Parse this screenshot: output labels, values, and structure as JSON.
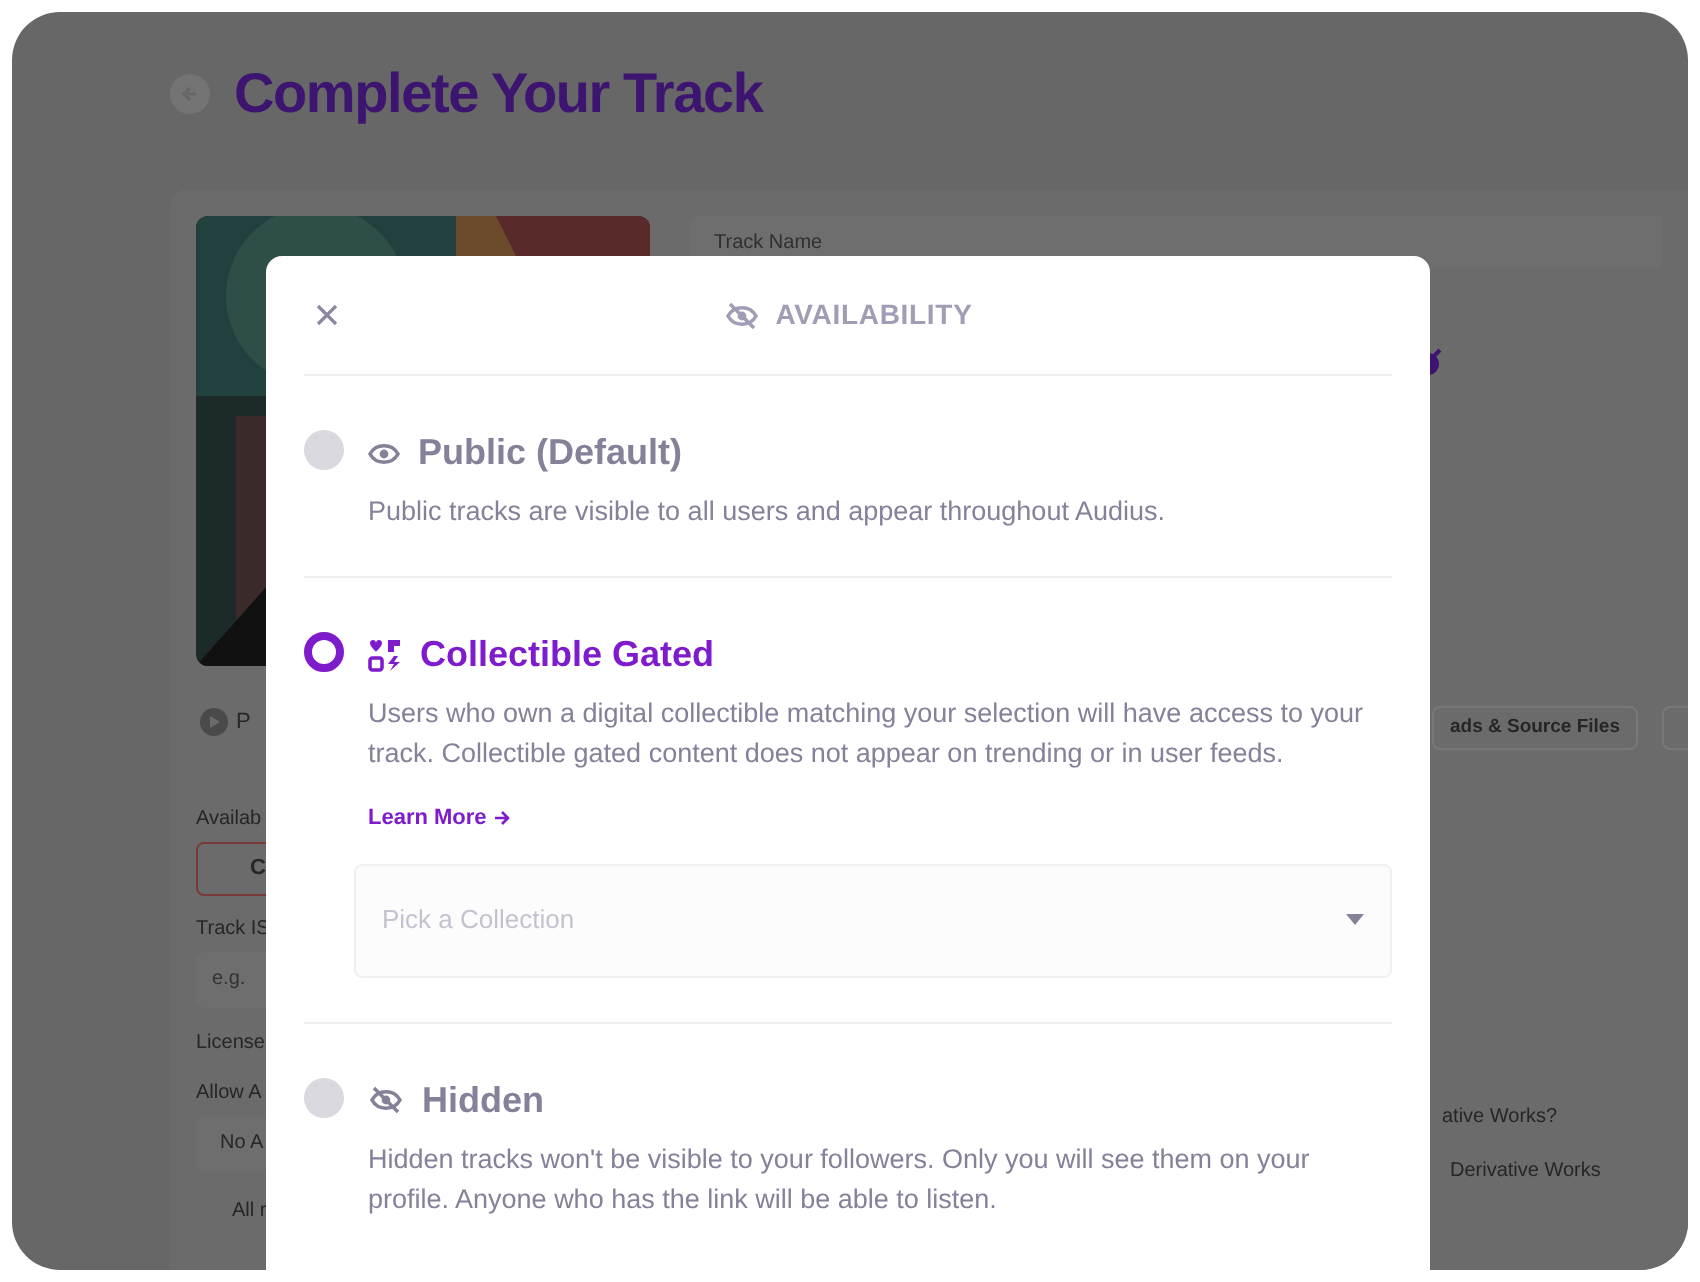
{
  "page": {
    "title": "Complete Your Track",
    "track_name_label": "Track Name",
    "preview_label": "P",
    "availability_label": "Availab",
    "availability_button": "C",
    "isrc_label": "Track IS",
    "isrc_placeholder": "e.g.",
    "license_label": "License",
    "allow_label": "Allow A",
    "allow_value": "No A",
    "rights_note": "All r",
    "downloads_button": "ads & Source Files",
    "derivative_question": "ative Works?",
    "derivative_value": "Derivative Works"
  },
  "modal": {
    "title": "AVAILABILITY",
    "options": [
      {
        "kind": "public",
        "title": "Public (Default)",
        "description": "Public tracks are visible to all users and appear throughout Audius.",
        "selected": false
      },
      {
        "kind": "collectible",
        "title": "Collectible Gated",
        "description": "Users who own a digital collectible matching your selection will have access to your track. Collectible gated content does not appear on trending or in user feeds.",
        "selected": true,
        "link": "Learn More",
        "select_placeholder": "Pick a Collection"
      },
      {
        "kind": "hidden",
        "title": "Hidden",
        "description": "Hidden tracks won't be visible to your followers. Only you will see them on your profile. Anyone who has the link will be able to listen.",
        "selected": false
      }
    ]
  }
}
